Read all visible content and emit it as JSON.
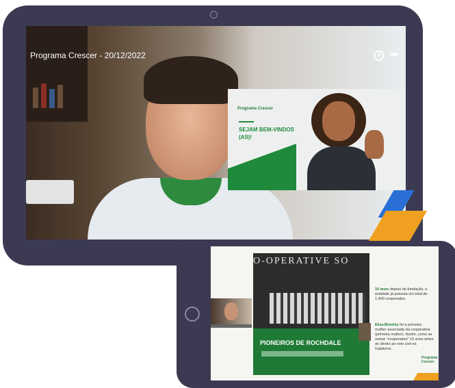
{
  "video": {
    "title": "Programa Crescer - 20/12/2022",
    "icons": [
      "clock-icon",
      "share-icon"
    ]
  },
  "slide": {
    "logo": "Programa Crescer",
    "welcome": "SEJAM BEM-VINDOS (AS)!"
  },
  "second_slide": {
    "sign": "O-OPERATIVE SO",
    "caption": "PIONEIROS DE ROCHDALE",
    "info1_bold": "10 anos",
    "info1_text": "depois da fundação, a entidade já possuía um total de 1.400 cooperados.",
    "info2_bold": "Eliza Brierley",
    "info2_text": "foi a primeira mulher associada da cooperativa (primeira mulher). Assim, como as outras \"cooperados\" 10 anos antes do direito ao voto civil na Inglaterra.",
    "logo": "Programa Crescer"
  },
  "colors": {
    "tablet_frame": "#3c3a52",
    "brand_green": "#1f8a3b",
    "accent_orange": "#f0a020",
    "accent_blue": "#2a6fd6"
  }
}
